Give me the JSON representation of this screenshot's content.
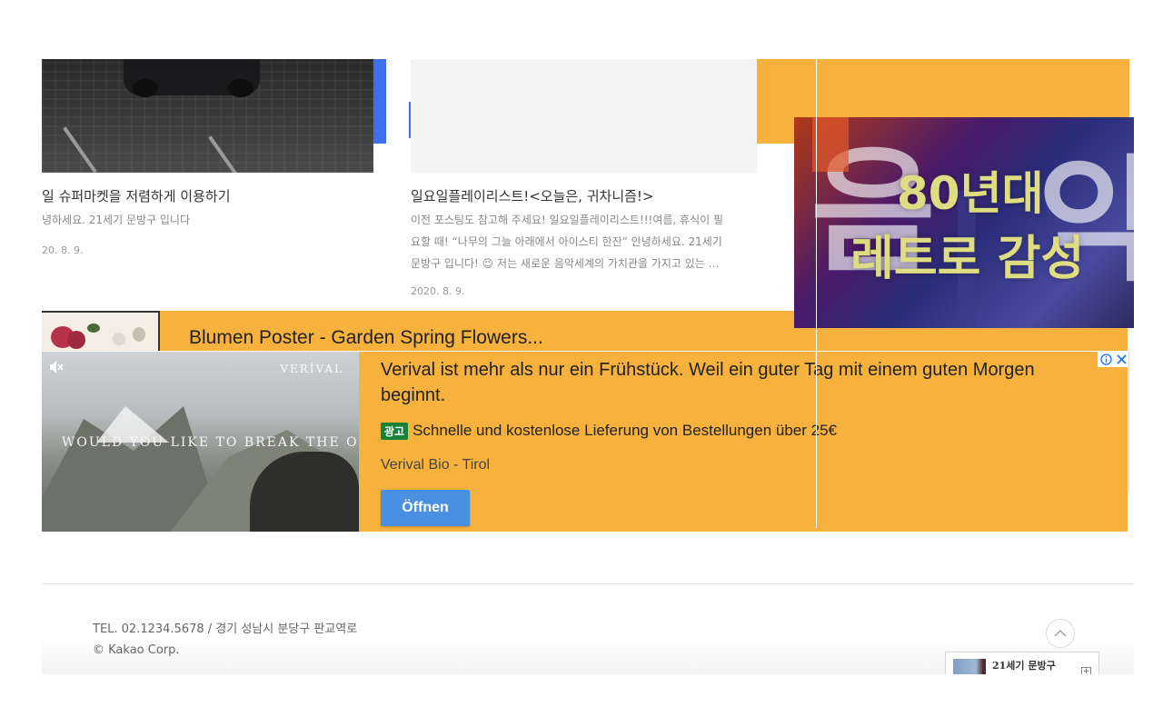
{
  "cards": [
    {
      "title": "일 슈퍼마켓을 저렴하게 이용하기",
      "desc_lines": [
        "녕하세요. 21세기 문방구 입니다"
      ],
      "date": "20. 8. 9."
    },
    {
      "title": "일요일플레이리스트!<오늘은, 귀차니즘!>",
      "desc_lines": [
        "이전 포스팅도 참고해 주세요! 일요일플레이리스트!!!여름, 휴식이 필",
        "요할 때! “나무의 그늘 아래에서 아이스티 한잔” 안녕하세요. 21세기",
        "문방구 입니다! 😉 저는 새로운 음악세계의 가치관을 가지고 있는 …"
      ],
      "date": "2020. 8. 9."
    }
  ],
  "video_ad": {
    "line1": "80년대",
    "line2": "레트로 감성"
  },
  "blumen_ad": {
    "title": "Blumen Poster - Garden Spring Flowers..."
  },
  "verival_ad": {
    "brand_logo": "VERÍVAL",
    "slogan": "WOULD YOU LIKE TO BREAK THE OLD WAYS",
    "headline": "Verival ist mehr als nur ein Frühstück. Weil ein guter Tag mit einem guten Morgen beginnt.",
    "badge": "광고",
    "subline": "Schnelle und kostenlose Lieferung von Bestellungen über 25€",
    "advertiser": "Verival Bio - Tirol",
    "cta": "Öffnen"
  },
  "footer": {
    "contact": "TEL. 02.1234.5678 / 경기 성남시 분당구 판교역로",
    "copyright": "© Kakao Corp.",
    "widget_name": "21세기 문방구"
  }
}
